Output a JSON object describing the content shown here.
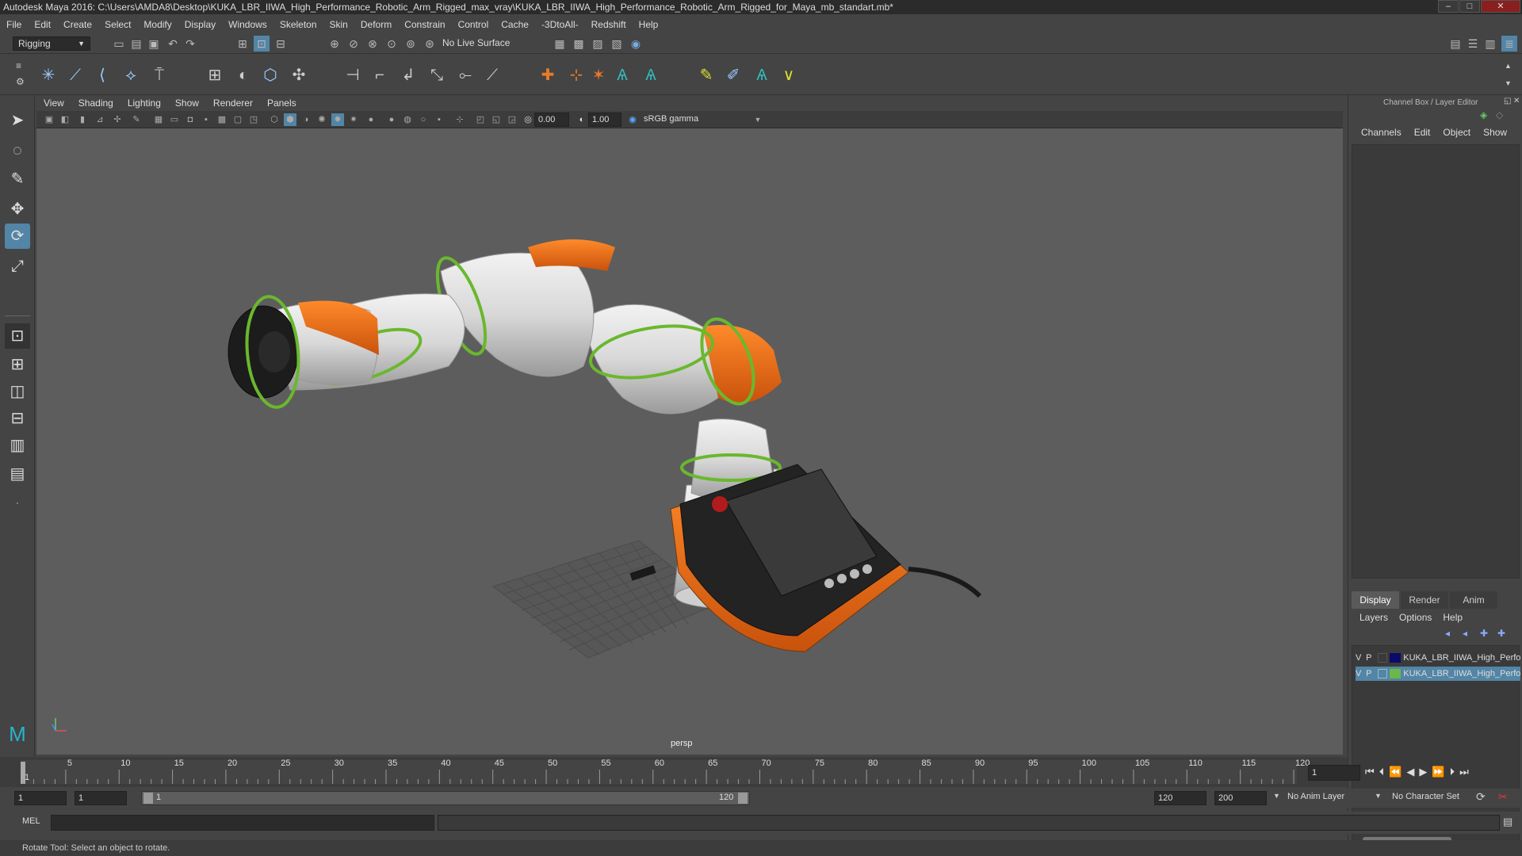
{
  "window": {
    "title": "Autodesk Maya 2016: C:\\Users\\AMDA8\\Desktop\\KUKA_LBR_IIWA_High_Performance_Robotic_Arm_Rigged_max_vray\\KUKA_LBR_IIWA_High_Performance_Robotic_Arm_Rigged_for_Maya_mb_standart.mb*",
    "minimize": "–",
    "maximize": "□",
    "close": "✕"
  },
  "menu": [
    "File",
    "Edit",
    "Create",
    "Select",
    "Modify",
    "Display",
    "Windows",
    "Skeleton",
    "Skin",
    "Deform",
    "Constrain",
    "Control",
    "Cache",
    "-3DtoAll-",
    "Redshift",
    "Help"
  ],
  "status_line": {
    "mode": "Rigging",
    "live_surface": "No Live Surface"
  },
  "panel_menu": [
    "View",
    "Shading",
    "Lighting",
    "Show",
    "Renderer",
    "Panels"
  ],
  "panel_toolbar": {
    "exposure": "0.00",
    "gamma": "1.00",
    "color_space": "sRGB gamma"
  },
  "viewport": {
    "camera_label": "persp"
  },
  "channel_box": {
    "title": "Channel Box / Layer Editor",
    "menu": [
      "Channels",
      "Edit",
      "Object",
      "Show"
    ]
  },
  "layer_editor": {
    "tabs": [
      "Display",
      "Render",
      "Anim"
    ],
    "menu": [
      "Layers",
      "Options",
      "Help"
    ],
    "layers": [
      {
        "v": "V",
        "p": "P",
        "name": "KUKA_LBR_IIWA_High_Perfor",
        "color": "#0a0a6a",
        "selected": false
      },
      {
        "v": "V",
        "p": "P",
        "name": "KUKA_LBR_IIWA_High_Perfor",
        "color": "#6ab84a",
        "selected": true
      }
    ]
  },
  "timeline": {
    "ticks": [
      "1",
      "5",
      "10",
      "15",
      "20",
      "25",
      "30",
      "35",
      "40",
      "45",
      "50",
      "55",
      "60",
      "65",
      "70",
      "75",
      "80",
      "85",
      "90",
      "95",
      "100",
      "105",
      "110",
      "115",
      "120"
    ],
    "current_frame": "1"
  },
  "range": {
    "start": "1",
    "playback_start": "1",
    "slider_start": "1",
    "slider_end": "120",
    "playback_end": "120",
    "end": "200",
    "anim_layer": "No Anim Layer",
    "character_set": "No Character Set"
  },
  "command_line": {
    "label": "MEL"
  },
  "help_line": {
    "text": "Rotate Tool: Select an object to rotate."
  },
  "colors": {
    "accent_selected": "#5285a6",
    "robot_orange": "#e0620f",
    "ring_green": "#6ab82e"
  }
}
